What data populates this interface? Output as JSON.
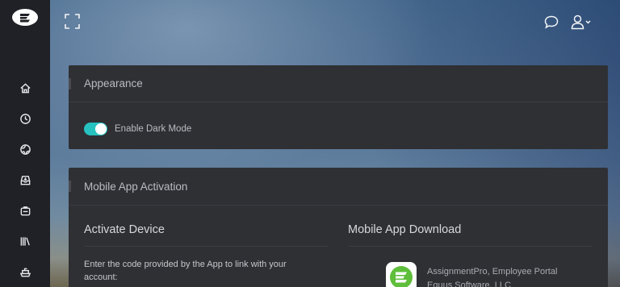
{
  "sidebar": {
    "logo": "equus-logo-icon",
    "items": [
      {
        "icon": "home-icon"
      },
      {
        "icon": "clock-icon"
      },
      {
        "icon": "globe-icon"
      },
      {
        "icon": "inbox-download-icon"
      },
      {
        "icon": "briefcase-icon"
      },
      {
        "icon": "library-books-icon"
      },
      {
        "icon": "ship-icon"
      }
    ]
  },
  "topbar": {
    "expand_icon": "fullscreen-expand-icon",
    "chat_icon": "chat-bubble-icon",
    "user_icon": "user-menu-icon"
  },
  "appearance": {
    "title": "Appearance",
    "dark_mode_label": "Enable Dark Mode",
    "dark_mode_enabled": true
  },
  "mobile": {
    "title": "Mobile App Activation",
    "activate_title": "Activate Device",
    "activate_desc": "Enter the code provided by the App to link with your account:",
    "download_title": "Mobile App Download",
    "app_name": "AssignmentPro, Employee Portal",
    "app_vendor": "Equus Software, LLC"
  },
  "colors": {
    "sidebar_bg": "#1f2126",
    "card_bg": "#2f3034",
    "toggle_on": "#27c2c0",
    "brand_green": "#5fbe3a"
  }
}
